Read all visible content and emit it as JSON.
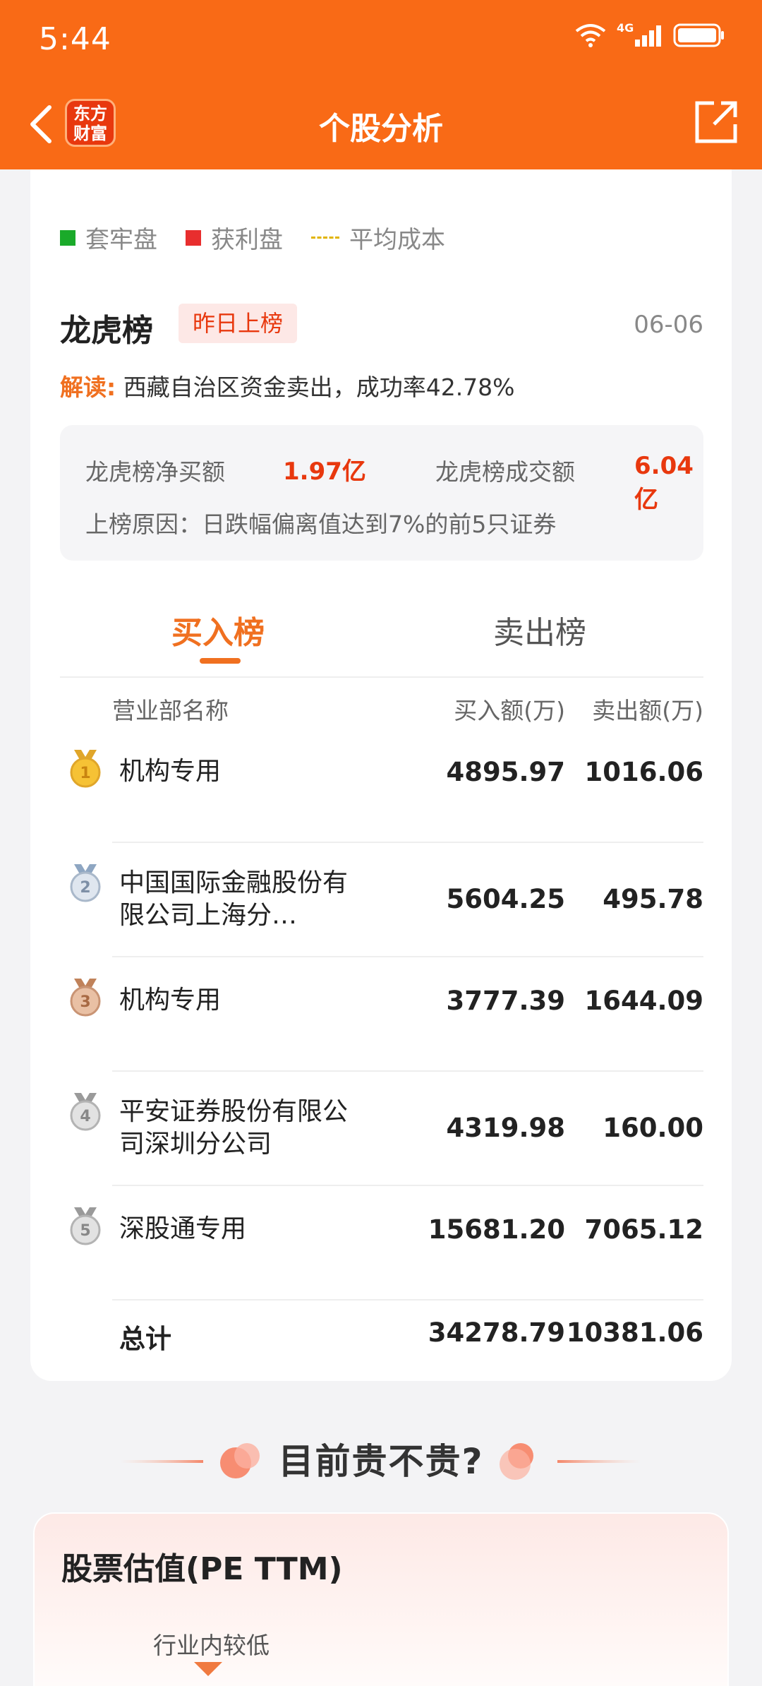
{
  "status": {
    "time": "5:44",
    "network": "4G"
  },
  "nav": {
    "title": "个股分析",
    "logo_text": "东方财富"
  },
  "legend": [
    {
      "label": "套牢盘",
      "color": "#1aaa2a"
    },
    {
      "label": "获利盘",
      "color": "#e82e2e"
    },
    {
      "label": "平均成本",
      "color": "#e2b400"
    }
  ],
  "lhb": {
    "title": "龙虎榜",
    "badge": "昨日上榜",
    "date": "06-06",
    "interpret_label": "解读:",
    "interpret_text": "西藏自治区资金卖出，成功率42.78%",
    "net_buy_label": "龙虎榜净买额",
    "net_buy_value": "1.97亿",
    "volume_label": "龙虎榜成交额",
    "volume_value": "6.04亿",
    "reason": "上榜原因：日跌幅偏离值达到7%的前5只证券"
  },
  "tabs": {
    "buy": "买入榜",
    "sell": "卖出榜"
  },
  "table": {
    "headers": {
      "name": "营业部名称",
      "buy": "买入额(万)",
      "sell": "卖出额(万)"
    },
    "rows": [
      {
        "rank": "1",
        "name": "机构专用",
        "buy": "4895.97",
        "sell": "1016.06"
      },
      {
        "rank": "2",
        "name": "中国国际金融股份有限公司上海分…",
        "buy": "5604.25",
        "sell": "495.78"
      },
      {
        "rank": "3",
        "name": "机构专用",
        "buy": "3777.39",
        "sell": "1644.09"
      },
      {
        "rank": "4",
        "name": "平安证券股份有限公司深圳分公司",
        "buy": "4319.98",
        "sell": "160.00"
      },
      {
        "rank": "5",
        "name": "深股通专用",
        "buy": "15681.20",
        "sell": "7065.12"
      }
    ],
    "total": {
      "name": "总计",
      "buy": "34278.79",
      "sell": "10381.06"
    }
  },
  "section2": {
    "title": "目前贵不贵?",
    "card_title": "股票估值(PE TTM)",
    "note": "行业内较低"
  }
}
